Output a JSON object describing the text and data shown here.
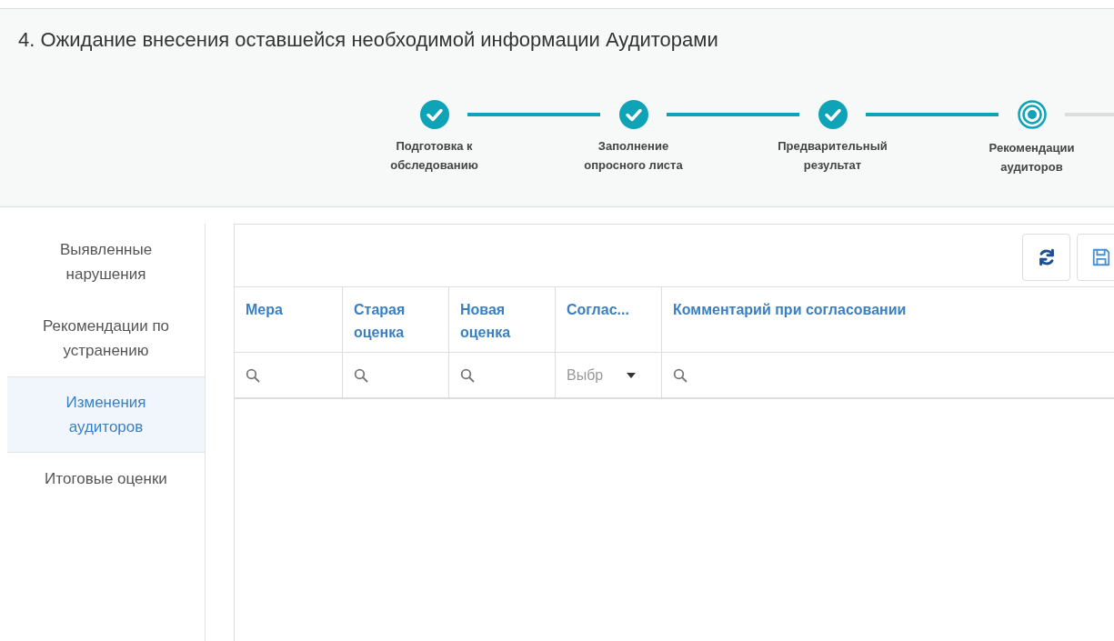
{
  "title": "4. Ожидание внесения оставшейся необходимой информации Аудиторами",
  "steps": [
    {
      "label": "Подготовка к обследованию",
      "kind": "done"
    },
    {
      "label": "Заполнение опросного листа",
      "kind": "done"
    },
    {
      "label": "Предварительный результат",
      "kind": "done"
    },
    {
      "label": "Рекомендации аудиторов",
      "kind": "current"
    }
  ],
  "sidebar": {
    "items": [
      {
        "label": "Выявленные нарушения",
        "selected": false
      },
      {
        "label": "Рекомендации по устранению",
        "selected": false
      },
      {
        "label": "Изменения аудиторов",
        "selected": true
      },
      {
        "label": "Итоговые оценки",
        "selected": false
      }
    ]
  },
  "table": {
    "columns": [
      {
        "label": "Мера",
        "kind": "search"
      },
      {
        "label": "Старая оценка",
        "kind": "search"
      },
      {
        "label": "Новая оценка",
        "kind": "search"
      },
      {
        "label": "Соглас...",
        "kind": "select",
        "placeholder": "Выбр"
      },
      {
        "label": "Комментарий при согласовании",
        "kind": "search"
      }
    ]
  }
}
